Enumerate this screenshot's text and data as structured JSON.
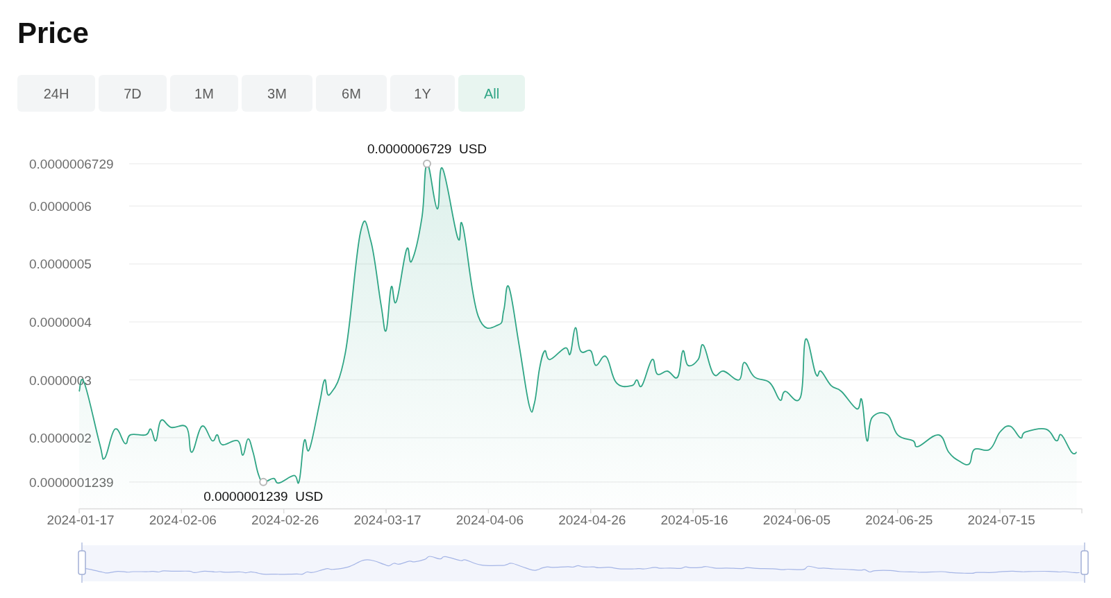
{
  "title": "Price",
  "range_tabs": [
    {
      "label": "24H",
      "selected": false
    },
    {
      "label": "7D",
      "selected": false
    },
    {
      "label": "1M",
      "selected": false
    },
    {
      "label": "3M",
      "selected": false
    },
    {
      "label": "6M",
      "selected": false
    },
    {
      "label": "1Y",
      "selected": false
    },
    {
      "label": "All",
      "selected": true
    }
  ],
  "chart": {
    "chart_data": {
      "type": "area",
      "x": [
        "2024-01-17",
        "2024-01-18",
        "2024-01-21",
        "2024-01-22",
        "2024-01-24",
        "2024-01-26",
        "2024-01-27",
        "2024-01-30",
        "2024-01-31",
        "2024-02-01",
        "2024-02-02",
        "2024-02-04",
        "2024-02-07",
        "2024-02-08",
        "2024-02-10",
        "2024-02-12",
        "2024-02-13",
        "2024-02-14",
        "2024-02-17",
        "2024-02-18",
        "2024-02-19",
        "2024-02-20",
        "2024-02-21",
        "2024-02-22",
        "2024-02-24",
        "2024-02-25",
        "2024-02-28",
        "2024-02-29",
        "2024-03-01",
        "2024-03-02",
        "2024-03-04",
        "2024-03-05",
        "2024-03-06",
        "2024-03-09",
        "2024-03-12",
        "2024-03-14",
        "2024-03-16",
        "2024-03-17",
        "2024-03-18",
        "2024-03-19",
        "2024-03-21",
        "2024-03-22",
        "2024-03-24",
        "2024-03-25",
        "2024-03-27",
        "2024-03-28",
        "2024-03-31",
        "2024-04-01",
        "2024-04-04",
        "2024-04-08",
        "2024-04-09",
        "2024-04-10",
        "2024-04-12",
        "2024-04-14",
        "2024-04-15",
        "2024-04-16",
        "2024-04-17",
        "2024-04-18",
        "2024-04-21",
        "2024-04-22",
        "2024-04-23",
        "2024-04-24",
        "2024-04-26",
        "2024-04-27",
        "2024-04-29",
        "2024-05-01",
        "2024-05-04",
        "2024-05-05",
        "2024-05-06",
        "2024-05-08",
        "2024-05-09",
        "2024-05-11",
        "2024-05-13",
        "2024-05-14",
        "2024-05-15",
        "2024-05-17",
        "2024-05-18",
        "2024-05-20",
        "2024-05-22",
        "2024-05-25",
        "2024-05-26",
        "2024-05-28",
        "2024-05-31",
        "2024-06-02",
        "2024-06-03",
        "2024-06-06",
        "2024-06-07",
        "2024-06-09",
        "2024-06-10",
        "2024-06-12",
        "2024-06-14",
        "2024-06-17",
        "2024-06-18",
        "2024-06-19",
        "2024-06-20",
        "2024-06-23",
        "2024-06-25",
        "2024-06-28",
        "2024-06-29",
        "2024-07-03",
        "2024-07-05",
        "2024-07-07",
        "2024-07-09",
        "2024-07-10",
        "2024-07-13",
        "2024-07-15",
        "2024-07-17",
        "2024-07-19",
        "2024-07-20",
        "2024-07-24",
        "2024-07-26",
        "2024-07-27",
        "2024-07-29",
        "2024-07-30"
      ],
      "grid": true,
      "series": [
        {
          "color": "#2fa585",
          "values": [
            2.8e-07,
            2.95e-07,
            1.9e-07,
            1.65e-07,
            2.15e-07,
            1.9e-07,
            2.05e-07,
            2.05e-07,
            2.15e-07,
            1.95e-07,
            2.3e-07,
            2.18e-07,
            2.18e-07,
            1.75e-07,
            2.2e-07,
            1.95e-07,
            2.05e-07,
            1.88e-07,
            1.95e-07,
            1.7e-07,
            1.98e-07,
            1.75e-07,
            1.38e-07,
            1.239e-07,
            1.3e-07,
            1.22e-07,
            1.35e-07,
            1.25e-07,
            1.95e-07,
            1.8e-07,
            2.6e-07,
            3e-07,
            2.75e-07,
            3.45e-07,
            5.55e-07,
            5.4e-07,
            4.3e-07,
            3.85e-07,
            4.6e-07,
            4.35e-07,
            5.25e-07,
            5.05e-07,
            5.8e-07,
            6.729e-07,
            5.95e-07,
            6.65e-07,
            5.45e-07,
            5.65e-07,
            4.1e-07,
            3.95e-07,
            4.2e-07,
            4.6e-07,
            3.6e-07,
            2.55e-07,
            2.6e-07,
            3.2e-07,
            3.5e-07,
            3.35e-07,
            3.55e-07,
            3.45e-07,
            3.9e-07,
            3.5e-07,
            3.5e-07,
            3.25e-07,
            3.4e-07,
            2.95e-07,
            2.9e-07,
            3e-07,
            2.9e-07,
            3.35e-07,
            3.1e-07,
            3.15e-07,
            3.05e-07,
            3.5e-07,
            3.25e-07,
            3.35e-07,
            3.6e-07,
            3.1e-07,
            3.15e-07,
            3e-07,
            3.3e-07,
            3.05e-07,
            2.95e-07,
            2.65e-07,
            2.8e-07,
            2.7e-07,
            3.7e-07,
            3.1e-07,
            3.15e-07,
            2.9e-07,
            2.8e-07,
            2.5e-07,
            2.65e-07,
            1.95e-07,
            2.35e-07,
            2.4e-07,
            2.05e-07,
            1.95e-07,
            1.85e-07,
            2.05e-07,
            1.75e-07,
            1.6e-07,
            1.55e-07,
            1.8e-07,
            1.8e-07,
            2.1e-07,
            2.2e-07,
            2e-07,
            2.1e-07,
            2.15e-07,
            1.95e-07,
            2.05e-07,
            1.75e-07,
            1.75e-07
          ]
        }
      ],
      "xlim": [
        "2024-01-17",
        "2024-07-31"
      ],
      "ylim": [
        7.8e-08,
        6.729e-07
      ],
      "xticks": [
        "2024-01-17",
        "2024-02-06",
        "2024-02-26",
        "2024-03-17",
        "2024-04-06",
        "2024-04-26",
        "2024-05-16",
        "2024-06-05",
        "2024-06-25",
        "2024-07-15"
      ],
      "yticks": [
        {
          "value": 1.239e-07,
          "label": "0.0000001239"
        },
        {
          "value": 2e-07,
          "label": "0.0000002"
        },
        {
          "value": 3e-07,
          "label": "0.0000003"
        },
        {
          "value": 4e-07,
          "label": "0.0000004"
        },
        {
          "value": 5e-07,
          "label": "0.0000005"
        },
        {
          "value": 6e-07,
          "label": "0.0000006"
        },
        {
          "value": 6.729e-07,
          "label": "0.0000006729"
        }
      ],
      "annotations": [
        {
          "x": "2024-03-25",
          "y": 6.729e-07,
          "text": "0.0000006729  USD"
        },
        {
          "x": "2024-02-22",
          "y": 1.239e-07,
          "text": "0.0000001239  USD"
        }
      ]
    }
  }
}
